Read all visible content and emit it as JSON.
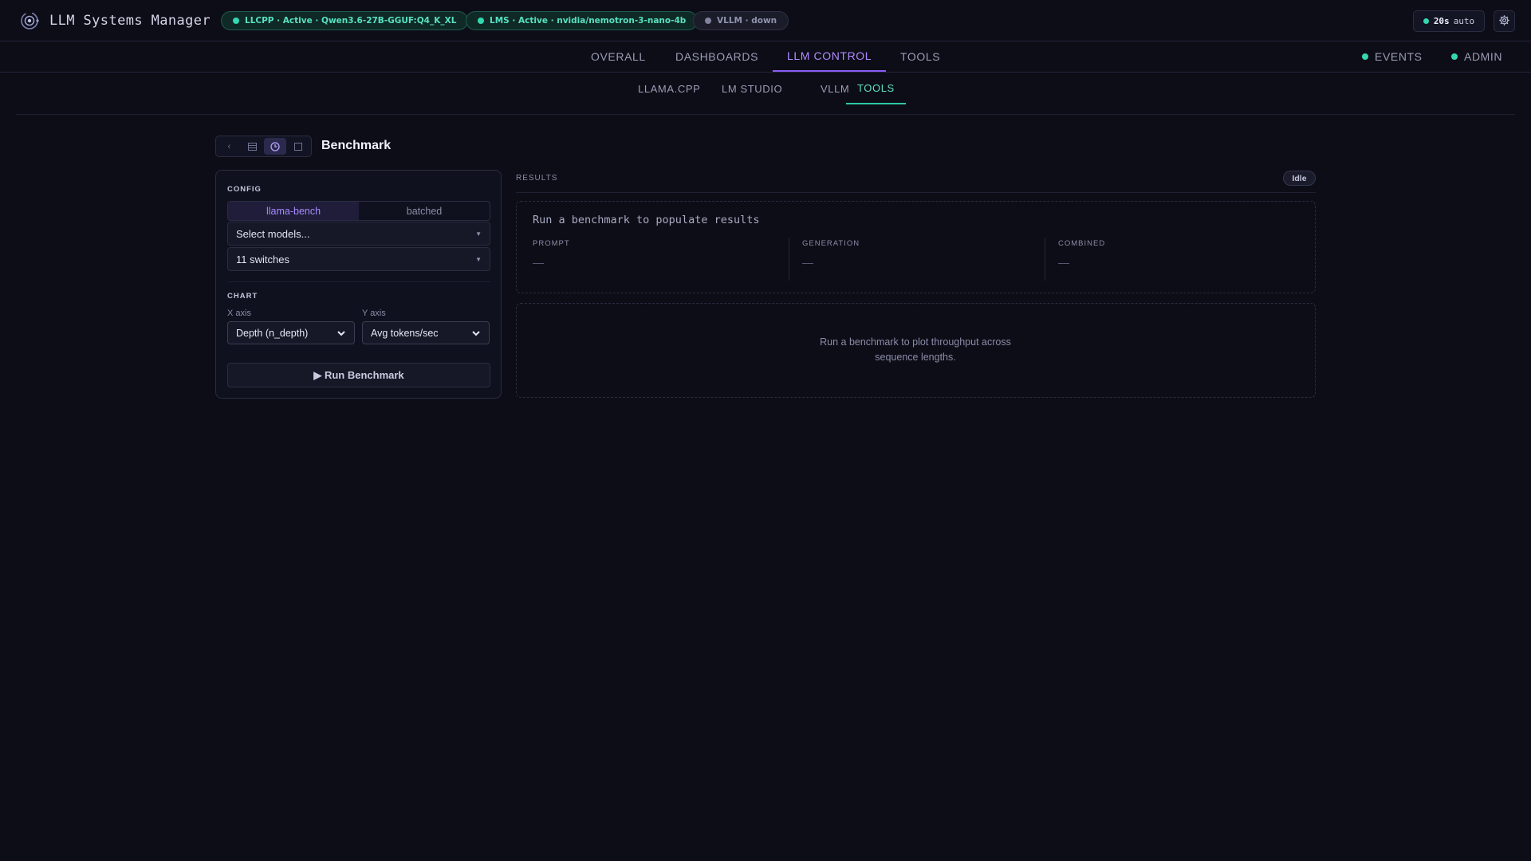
{
  "app": {
    "title": "LLM Systems Manager"
  },
  "status_pills": {
    "llcpp": "LLCPP · Active · Qwen3.6-27B-GGUF:Q4_K_XL",
    "lms": "LMS · Active · nvidia/nemotron-3-nano-4b",
    "vllm": "VLLM · down"
  },
  "refresh": {
    "interval": "20s",
    "mode": "auto"
  },
  "nav": {
    "tabs": [
      "OVERALL",
      "DASHBOARDS",
      "LLM CONTROL",
      "TOOLS"
    ],
    "active_tab": "LLM CONTROL",
    "right": [
      "EVENTS",
      "ADMIN"
    ]
  },
  "subnav": {
    "tabs": [
      "LLAMA.CPP",
      "LM STUDIO",
      "VLLM",
      "TOOLS"
    ],
    "active_tab": "TOOLS"
  },
  "tool": {
    "title": "Benchmark",
    "buttons": [
      "back-icon",
      "list-icon",
      "clock-icon",
      "square-icon"
    ],
    "active_button": "clock-icon"
  },
  "config": {
    "label": "CONFIG",
    "modes": [
      "llama-bench",
      "batched"
    ],
    "active_mode": "llama-bench",
    "model_select": "Select models...",
    "switches": "11 switches"
  },
  "chart": {
    "label": "CHART",
    "x_label": "X axis",
    "x_value": "Depth (n_depth)",
    "y_label": "Y axis",
    "y_value": "Avg tokens/sec",
    "run_button": "▶ Run Benchmark"
  },
  "results": {
    "label": "RESULTS",
    "status": "Idle",
    "empty_title": "Run a benchmark to populate results",
    "metrics": [
      {
        "label": "PROMPT",
        "value": "—"
      },
      {
        "label": "GENERATION",
        "value": "—"
      },
      {
        "label": "COMBINED",
        "value": "—"
      }
    ],
    "plot_message_line1": "Run a benchmark to plot throughput across",
    "plot_message_line2": "sequence lengths."
  },
  "colors": {
    "background": "#0d0d17",
    "accent_purple": "#8b5cf6",
    "accent_teal": "#2ec9a6",
    "status_green": "#34d8b0"
  }
}
